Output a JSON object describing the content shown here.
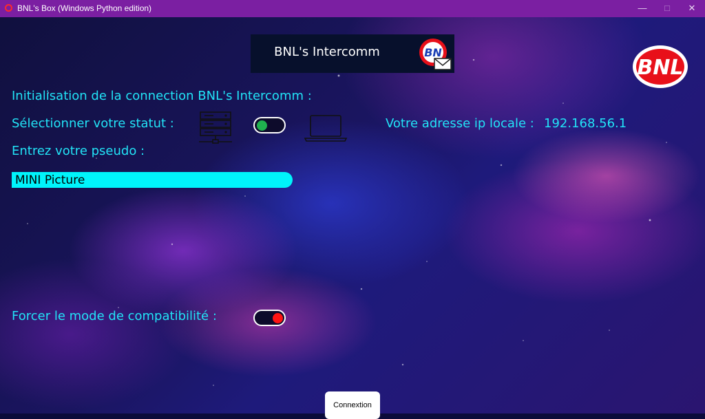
{
  "window": {
    "title": "BNL's Box (Windows Python edition)",
    "controls": {
      "minimize": "—",
      "maximize": "□",
      "close": "✕"
    }
  },
  "header": {
    "title": "BNL's Intercomm",
    "logo_icon": "bnl-mail-logo",
    "brand_logo_text": "BNL"
  },
  "form": {
    "init_label": "Initialisation de la connection BNL's Intercomm :",
    "status_label": "Sélectionner votre statut :",
    "status_options": {
      "left_icon": "server-icon",
      "right_icon": "laptop-icon"
    },
    "status_toggle_on": true,
    "ip_label": "Votre adresse ip locale :",
    "ip_value": "192.168.56.1",
    "pseudo_label": "Entrez votre pseudo :",
    "pseudo_value": "MINI Picture",
    "compat_label": "Forcer le mode de compatibilité :",
    "compat_toggle_on": false,
    "connect_label": "Connextion"
  },
  "colors": {
    "titlebar": "#7b1fa2",
    "accent_text": "#22e4f7",
    "input_bg": "#00f4fb",
    "toggle_on": "#1fb14f",
    "toggle_off": "#ff1414",
    "brand_red": "#e8101a"
  }
}
